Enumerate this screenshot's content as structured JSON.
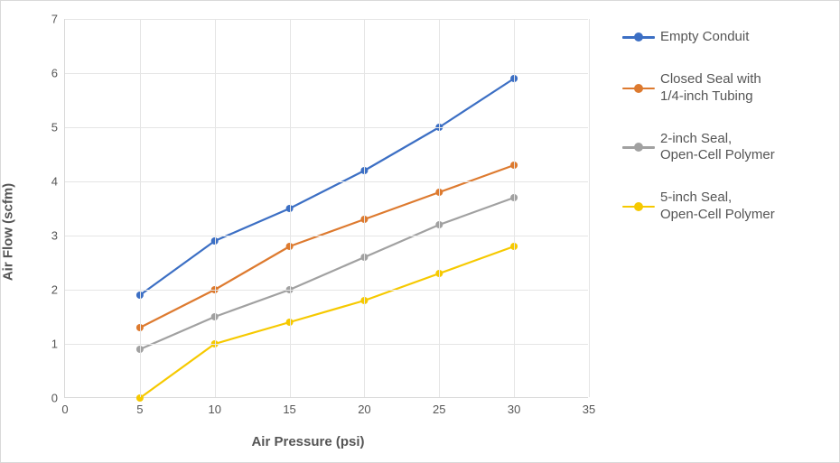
{
  "chart_data": {
    "type": "line",
    "xlabel": "Air Pressure (psi)",
    "ylabel": "Air Flow (scfm)",
    "xlim": [
      0,
      35
    ],
    "ylim": [
      0,
      7
    ],
    "xticks": [
      0,
      5,
      10,
      15,
      20,
      25,
      30,
      35
    ],
    "yticks": [
      0,
      1,
      2,
      3,
      4,
      5,
      6,
      7
    ],
    "x": [
      5,
      10,
      15,
      20,
      25,
      30
    ],
    "series": [
      {
        "name": "Empty Conduit",
        "color": "#3c6fc4",
        "values": [
          1.9,
          2.9,
          3.5,
          4.2,
          5.0,
          5.9
        ]
      },
      {
        "name": "Closed Seal with\n1/4-inch Tubing",
        "color": "#dd7a2f",
        "values": [
          1.3,
          2.0,
          2.8,
          3.3,
          3.8,
          4.3
        ]
      },
      {
        "name": "2-inch Seal,\nOpen-Cell Polymer",
        "color": "#a1a1a1",
        "values": [
          0.9,
          1.5,
          2.0,
          2.6,
          3.2,
          3.7
        ]
      },
      {
        "name": "5-inch Seal,\nOpen-Cell Polymer",
        "color": "#f6c900",
        "values": [
          0.0,
          1.0,
          1.4,
          1.8,
          2.3,
          2.8
        ]
      }
    ]
  }
}
